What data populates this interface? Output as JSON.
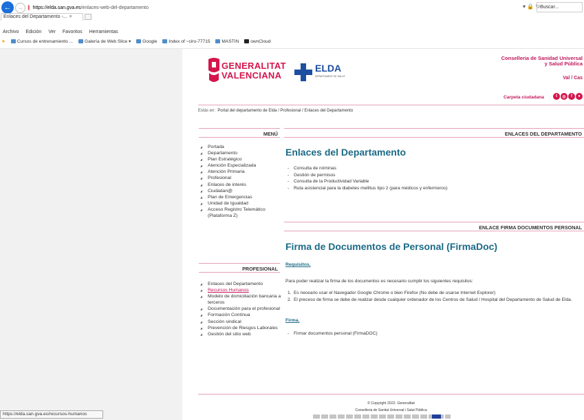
{
  "browser": {
    "url_scheme_host": "https://elda.san.gva.es",
    "url_path": "/enlaces-web-del-departamento",
    "search_placeholder": "Buscar...",
    "tab_title": "Enlaces del Departamento -...",
    "tab_close": "×",
    "menu": [
      "Archivo",
      "Edición",
      "Ver",
      "Favoritos",
      "Herramientas"
    ],
    "favorites": [
      "Cursos de entrenamiento ...",
      "Galería de Web Slice ▾",
      "Google",
      "Index of ~ciro-77715",
      "MASTIN",
      "ownCloud"
    ],
    "status_url": "https://elda.san.gva.es/recursos-humanos"
  },
  "header": {
    "gva_line1": "GENERALITAT",
    "gva_line2": "VALENCIANA",
    "elda_name": "ELDA",
    "elda_sub": "DEPARTAMENT DE SALUT",
    "conselleria_line1": "Conselleria de Sanidad Universal",
    "conselleria_line2": "y Salud Pública",
    "lang": "Val / Cas",
    "carpeta": "Carpeta ciudadana"
  },
  "breadcrumb": {
    "label": "Estás en:",
    "items": "Portal del departamento de Elda  /  Profesional  /  Enlaces del Departamento"
  },
  "menu": {
    "title": "MENÚ",
    "items": [
      "Portada",
      "Departamento",
      "Plan Estratégico",
      "Atención Especializada",
      "Atención Primaria",
      "Profesional",
      "Enlaces de interés",
      "Ciudadan@",
      "Plan de Emergencias",
      "Unidad de Igualdad",
      "Acceso Registro Telemático (Plataforma Z)"
    ]
  },
  "profesional": {
    "title": "PROFESIONAL",
    "items": [
      "Enlaces del Departamento",
      "Recursos Humanos",
      "Modelo de domiciliación bancaria a terceros",
      "Documentación para el profesional",
      "Formación Contínua",
      "Sección sindical",
      "Prevención de Riesgos Laborales",
      "Gestión del sitio web"
    ]
  },
  "enlaces": {
    "header": "ENLACES DEL DEPARTAMENTO",
    "title": "Enlaces del Departamento",
    "items": [
      "Consulta de nóminas",
      "Gestión de permisos",
      "Consulta de la Productividad Variable",
      "Ruta asistencial para la diabetes mellitus tipo 2 (para médicos y enfermeros)"
    ]
  },
  "firma": {
    "header": "ENLACE FIRMA DOCUMENTOS PERSONAL",
    "title": "Firma de Documentos de Personal (FirmaDoc)",
    "req_label": "Requisitos.",
    "req_text": "Para poder realizar la firma de los documentos es necesario cumplir los siguientes requisitos:",
    "req_items": [
      "Es neceario usar el Navegador Google Chrome o bien Firefox (No debe de usarse Internet Explorer)",
      "El preceso de firma se debe de realizar desde cualquier ordenador de los Centros de Salud / Hospital del Departamento de Salud de Elda."
    ],
    "firma_label": "Firma.",
    "firma_items": [
      "Firmar documentos personal (FirmaDOC)"
    ]
  },
  "footer": {
    "copyright": "© Copyright 2022. Generalitat",
    "conselleria": "Conselleria de Sanitat Universal i Salut Pública"
  }
}
